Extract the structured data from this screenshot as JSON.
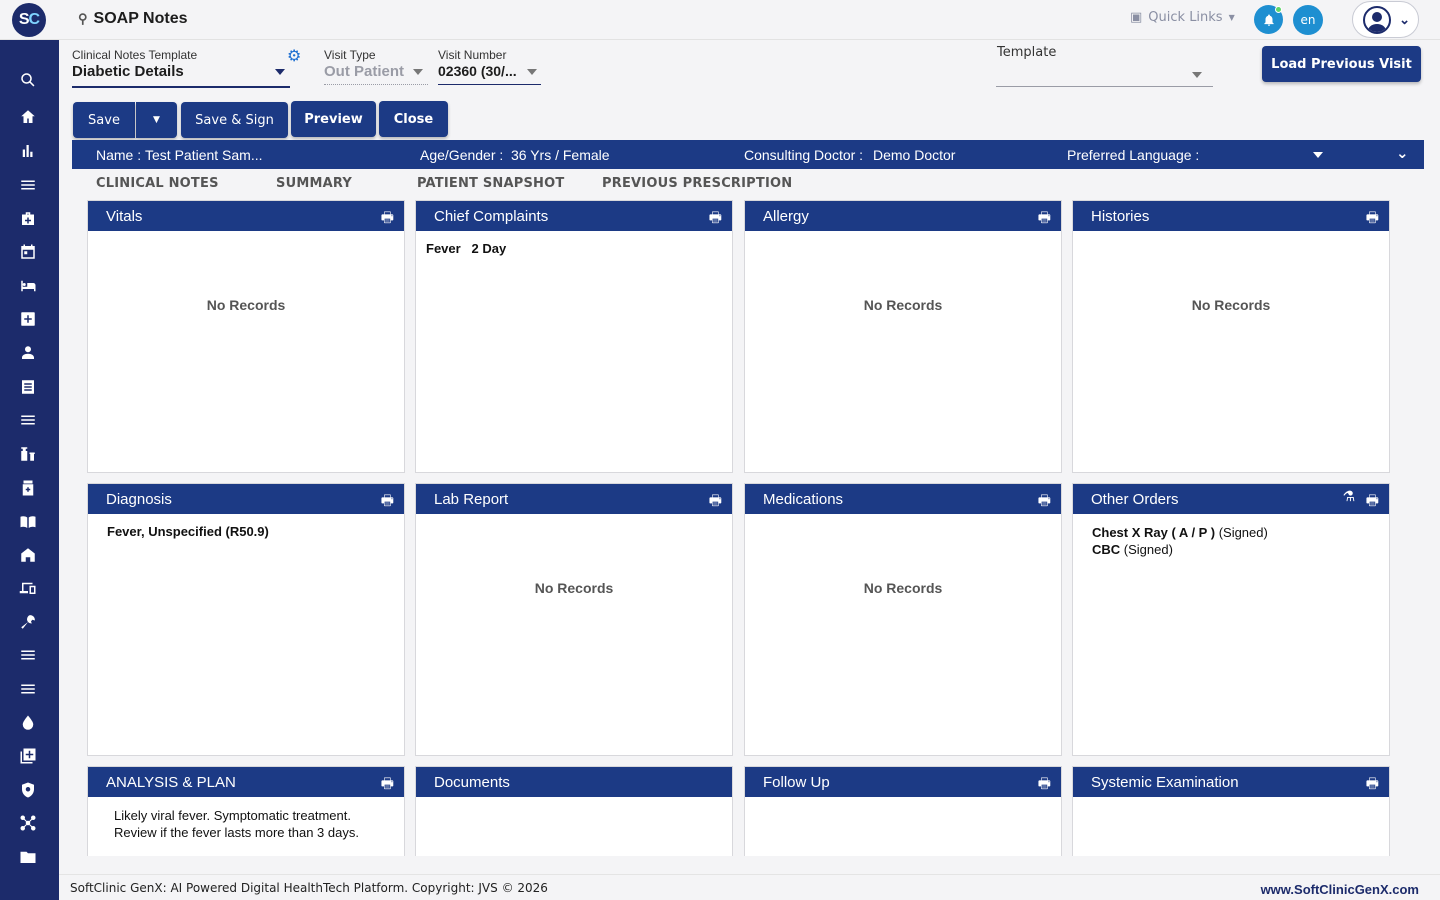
{
  "app": {
    "logo": "SC",
    "title": "SOAP Notes"
  },
  "topbar": {
    "quick_links": "Quick Links",
    "language": "en"
  },
  "form": {
    "template_label": "Clinical Notes Template",
    "template_value": "Diabetic Details",
    "visit_type_label": "Visit Type",
    "visit_type_value": "Out Patient",
    "visit_number_label": "Visit Number",
    "visit_number_value": "02360 (30/...",
    "template2_label": "Template",
    "template2_value": "",
    "load_previous": "Load Previous Visit"
  },
  "actions": {
    "save": "Save",
    "save_sign": "Save & Sign",
    "preview": "Preview",
    "close": "Close"
  },
  "patient": {
    "name_label": "Name :",
    "name": "Test Patient Sam...",
    "age_label": "Age/Gender :",
    "age": "36 Yrs / Female",
    "doctor_label": "Consulting Doctor :",
    "doctor": "Demo Doctor",
    "language_label": "Preferred Language :"
  },
  "tabs": [
    "CLINICAL NOTES",
    "SUMMARY",
    "PATIENT SNAPSHOT",
    "PREVIOUS PRESCRIPTION"
  ],
  "no_records": "No Records",
  "cards": {
    "vitals": {
      "title": "Vitals"
    },
    "chief": {
      "title": "Chief Complaints",
      "item": "Fever",
      "duration": "2 Day"
    },
    "allergy": {
      "title": "Allergy"
    },
    "histories": {
      "title": "Histories"
    },
    "diagnosis": {
      "title": "Diagnosis",
      "item": "Fever, Unspecified (R50.9)"
    },
    "lab": {
      "title": "Lab Report"
    },
    "medications": {
      "title": "Medications"
    },
    "orders": {
      "title": "Other Orders",
      "items": [
        {
          "name": "Chest X Ray ( A / P )",
          "status": "(Signed)"
        },
        {
          "name": "CBC",
          "status": "(Signed)"
        }
      ]
    },
    "analysis": {
      "title": "ANALYSIS & PLAN",
      "line1": "Likely viral fever. Symptomatic treatment.",
      "line2": "Review if the fever lasts more than 3 days."
    },
    "documents": {
      "title": "Documents"
    },
    "followup": {
      "title": "Follow Up"
    },
    "systemic": {
      "title": "Systemic Examination"
    }
  },
  "footer": {
    "copyright": "SoftClinic GenX: AI Powered Digital HealthTech Platform. Copyright: JVS © 2026",
    "website": "www.SoftClinicGenX.com"
  },
  "colors": {
    "primary": "#1c3a85",
    "sidebar": "#1c2b6b",
    "accent": "#1e8fd1"
  },
  "sidebar_icons": [
    "search-icon",
    "home-icon",
    "bar-chart-icon",
    "menu-icon",
    "briefcase-medical-icon",
    "calendar-icon",
    "bed-icon",
    "plus-square-icon",
    "user-icon",
    "document-list-icon",
    "menu-icon",
    "pills-icon",
    "medicine-bottle-icon",
    "book-icon",
    "building-icon",
    "devices-icon",
    "wrench-icon",
    "menu-icon",
    "menu-icon",
    "drop-icon",
    "add-stack-icon",
    "shield-icon",
    "network-icon",
    "folder-icon"
  ]
}
